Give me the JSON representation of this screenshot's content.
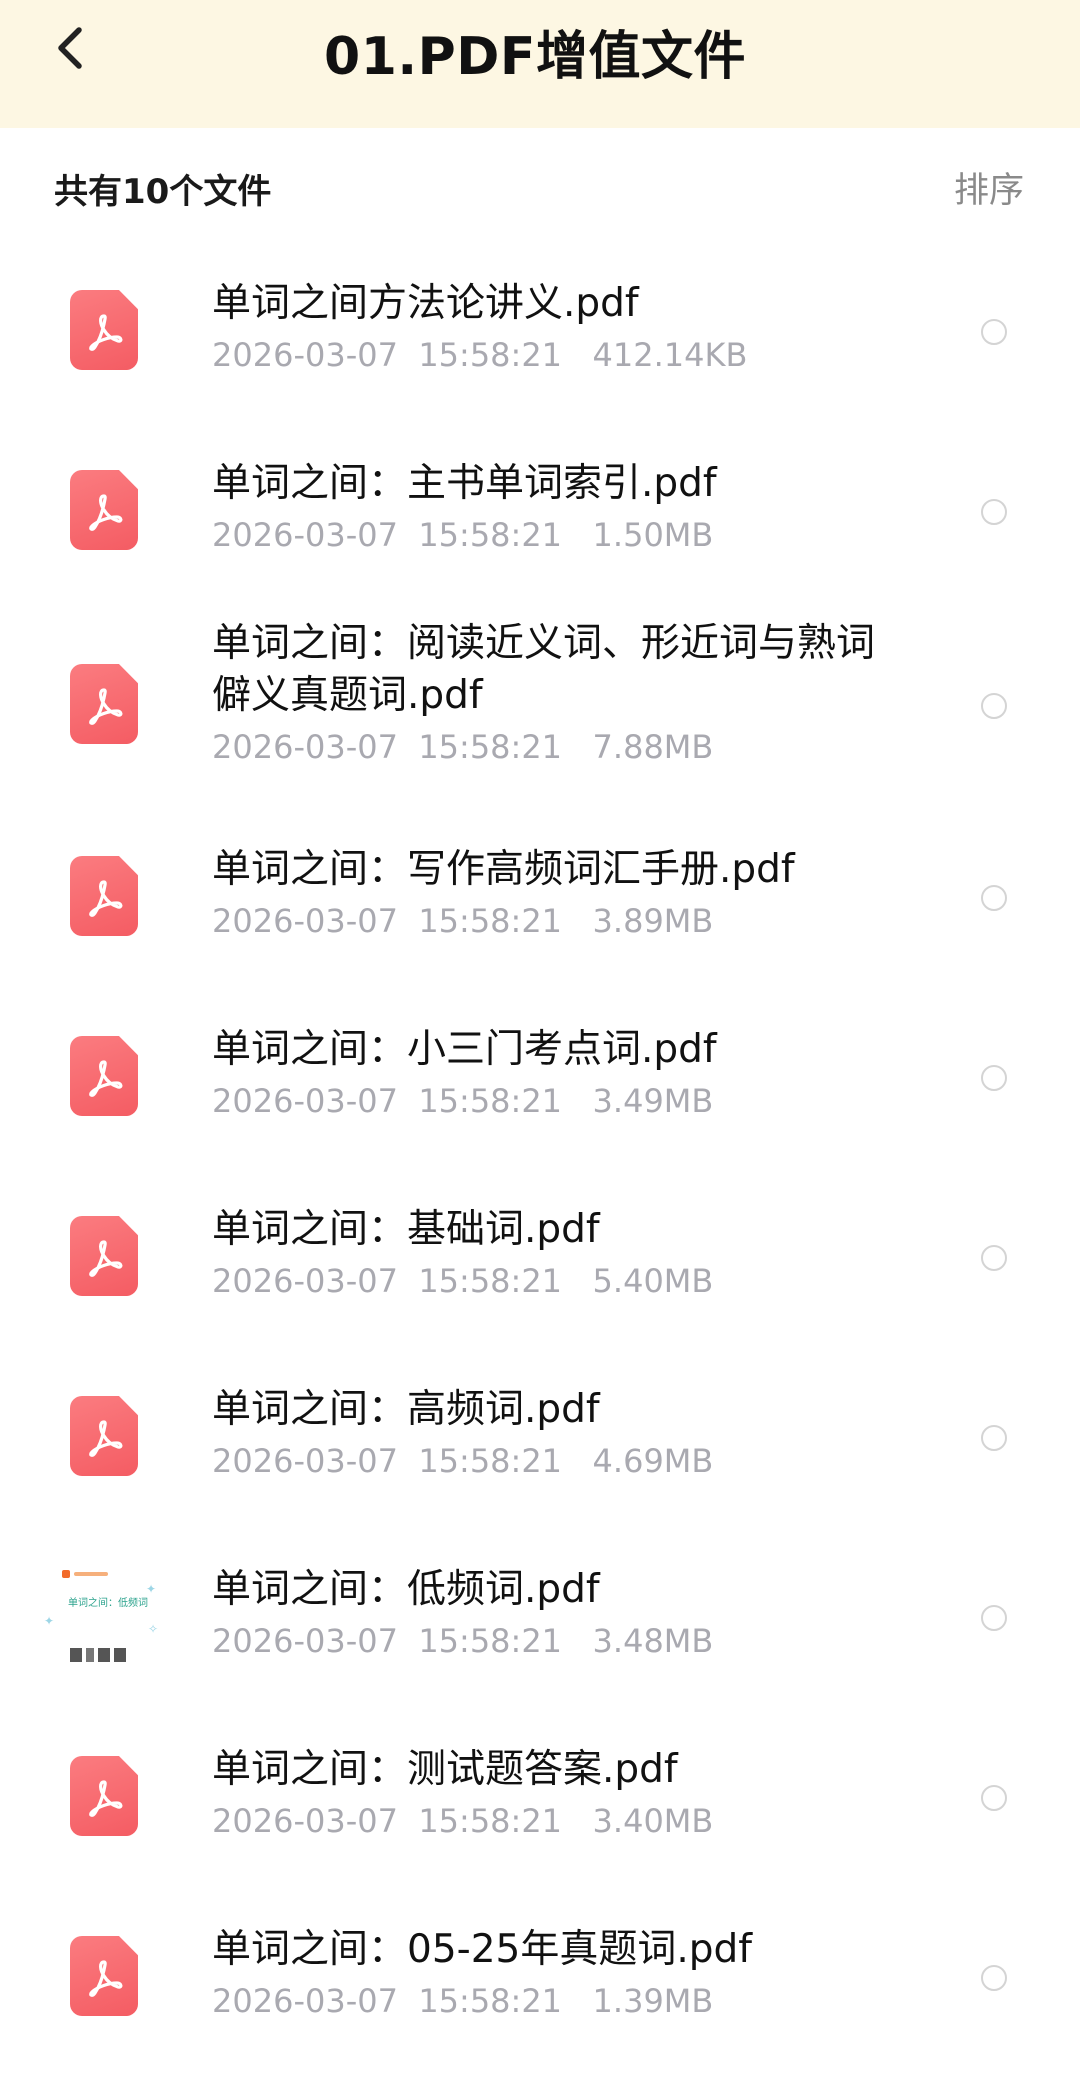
{
  "header": {
    "title": "01.PDF增值文件",
    "back_icon": "chevron-left-icon"
  },
  "toolbar": {
    "count_label": "共有10个文件",
    "sort_label": "排序"
  },
  "colors": {
    "header_bg": "#fdf7e3",
    "pdf_icon": "#f45c63",
    "meta_text": "#a9a9b0"
  },
  "files": [
    {
      "name": "单词之间方法论讲义.pdf",
      "date": "2026-03-07",
      "time": "15:58:21",
      "size": "412.14KB",
      "icon": "pdf-icon"
    },
    {
      "name": "单词之间：主书单词索引.pdf",
      "date": "2026-03-07",
      "time": "15:58:21",
      "size": "1.50MB",
      "icon": "pdf-icon"
    },
    {
      "name": "单词之间：阅读近义词、形近词与熟词僻义真题词.pdf",
      "date": "2026-03-07",
      "time": "15:58:21",
      "size": "7.88MB",
      "icon": "pdf-icon"
    },
    {
      "name": "单词之间：写作高频词汇手册.pdf",
      "date": "2026-03-07",
      "time": "15:58:21",
      "size": "3.89MB",
      "icon": "pdf-icon"
    },
    {
      "name": "单词之间：小三门考点词.pdf",
      "date": "2026-03-07",
      "time": "15:58:21",
      "size": "3.49MB",
      "icon": "pdf-icon"
    },
    {
      "name": "单词之间：基础词.pdf",
      "date": "2026-03-07",
      "time": "15:58:21",
      "size": "5.40MB",
      "icon": "pdf-icon"
    },
    {
      "name": "单词之间：高频词.pdf",
      "date": "2026-03-07",
      "time": "15:58:21",
      "size": "4.69MB",
      "icon": "pdf-icon"
    },
    {
      "name": "单词之间：低频词.pdf",
      "date": "2026-03-07",
      "time": "15:58:21",
      "size": "3.48MB",
      "icon": "document-thumbnail",
      "thumb_text": "单词之间：低频词"
    },
    {
      "name": "单词之间：测试题答案.pdf",
      "date": "2026-03-07",
      "time": "15:58:21",
      "size": "3.40MB",
      "icon": "pdf-icon"
    },
    {
      "name": "单词之间：05-25年真题词.pdf",
      "date": "2026-03-07",
      "time": "15:58:21",
      "size": "1.39MB",
      "icon": "pdf-icon"
    }
  ]
}
